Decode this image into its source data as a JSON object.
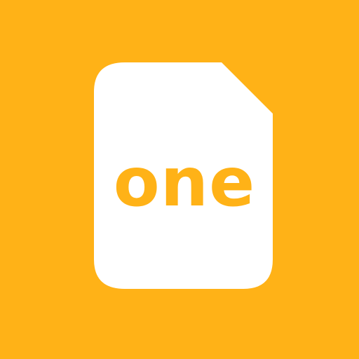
{
  "app_icon": {
    "wordmark": "one",
    "icon": "document-page-icon",
    "colors": {
      "background": "#FFB217",
      "page": "#FFFFFF",
      "text": "#FFB217"
    }
  }
}
